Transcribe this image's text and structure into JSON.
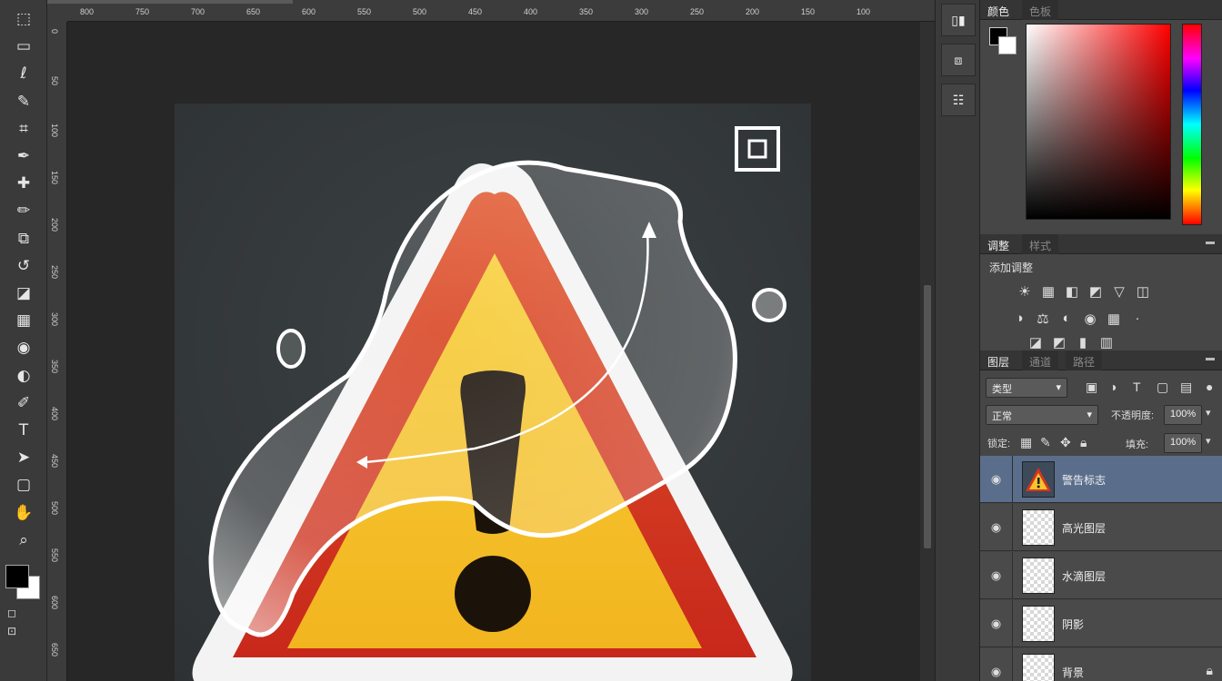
{
  "colors": {
    "accent_selected_layer": "#5a6e8c",
    "warning_red": "#d7341f",
    "warning_yellow": "#f6c42b"
  },
  "toolbar": {
    "tools": [
      {
        "glyph": "⬚",
        "name": "move-tool-icon"
      },
      {
        "glyph": "▭",
        "name": "marquee-tool-icon"
      },
      {
        "glyph": "ℓ",
        "name": "lasso-tool-icon"
      },
      {
        "glyph": "✎",
        "name": "quick-select-tool-icon"
      },
      {
        "glyph": "⌗",
        "name": "crop-tool-icon"
      },
      {
        "glyph": "✒",
        "name": "eyedropper-tool-icon"
      },
      {
        "glyph": "✚",
        "name": "healing-tool-icon"
      },
      {
        "glyph": "✏",
        "name": "brush-tool-icon"
      },
      {
        "glyph": "⧉",
        "name": "clone-stamp-tool-icon"
      },
      {
        "glyph": "↺",
        "name": "history-brush-tool-icon"
      },
      {
        "glyph": "◪",
        "name": "eraser-tool-icon"
      },
      {
        "glyph": "▦",
        "name": "gradient-tool-icon"
      },
      {
        "glyph": "◉",
        "name": "blur-tool-icon"
      },
      {
        "glyph": "◐",
        "name": "dodge-tool-icon"
      },
      {
        "glyph": "✐",
        "name": "pen-tool-icon"
      },
      {
        "glyph": "T",
        "name": "type-tool-icon"
      },
      {
        "glyph": "➤",
        "name": "path-select-tool-icon"
      },
      {
        "glyph": "▢",
        "name": "shape-tool-icon"
      },
      {
        "glyph": "✋",
        "name": "hand-tool-icon"
      },
      {
        "glyph": "⌕",
        "name": "zoom-tool-icon"
      }
    ],
    "mode_label": "◻",
    "screen_label": "⊡"
  },
  "ruler": {
    "top_ticks": [
      "800",
      "750",
      "700",
      "650",
      "600",
      "550",
      "500",
      "450",
      "400",
      "350",
      "300",
      "250",
      "200",
      "150",
      "100"
    ],
    "left_ticks": [
      "0",
      "50",
      "100",
      "150",
      "200",
      "250",
      "300",
      "350",
      "400",
      "450",
      "500",
      "550",
      "600",
      "650"
    ]
  },
  "iconcol": {
    "icons": [
      "▯▮",
      "⧈",
      "☷"
    ]
  },
  "color_panel": {
    "tab_active": "颜色",
    "tab_inactive": "色板"
  },
  "adjustments": {
    "tab_active": "调整",
    "tab_inactive": "样式",
    "title": "添加调整",
    "row1": [
      "☀",
      "▦",
      "◧",
      "◩",
      "▽",
      "◫"
    ],
    "row2": [
      "◑",
      "⚖",
      "◐",
      "◉",
      "▦",
      "·"
    ],
    "row3": [
      "◪",
      "◩",
      "▮",
      "▥"
    ]
  },
  "layers": {
    "tab_active": "图层",
    "tab2": "通道",
    "tab3": "路径",
    "kind_filter": "类型",
    "blend_mode": "正常",
    "opacity_label": "不透明度:",
    "opacity_value": "100%",
    "lock_label": "锁定:",
    "fill_label": "填充:",
    "fill_value": "100%",
    "items": [
      {
        "name": "警告标志",
        "selected": true,
        "thumb": "warn",
        "locked": false
      },
      {
        "name": "高光图层",
        "selected": false,
        "thumb": "transparent",
        "locked": false
      },
      {
        "name": "水滴图层",
        "selected": false,
        "thumb": "transparent",
        "locked": false
      },
      {
        "name": "阴影",
        "selected": false,
        "thumb": "transparent",
        "locked": false
      },
      {
        "name": "背景",
        "selected": false,
        "thumb": "transparent",
        "locked": true
      }
    ]
  }
}
